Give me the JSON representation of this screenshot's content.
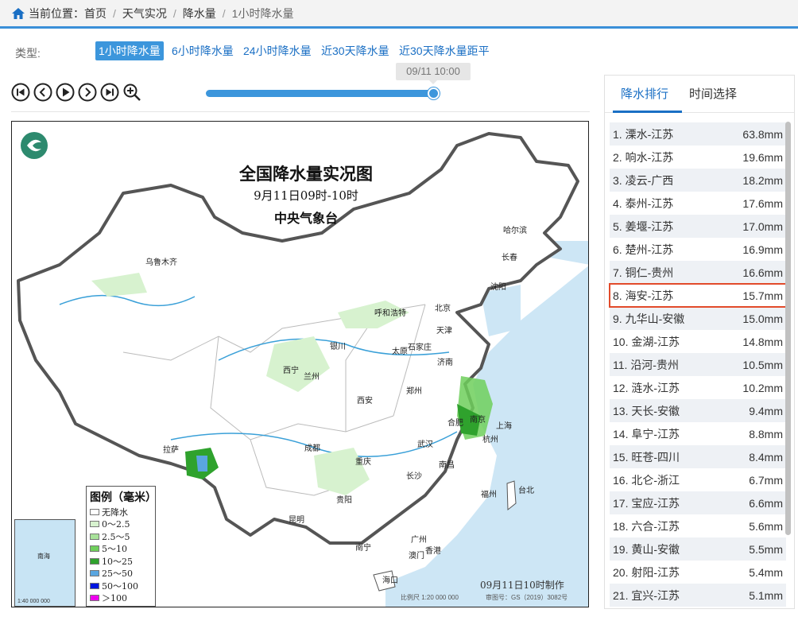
{
  "breadcrumb": {
    "prefix": "当前位置：",
    "items": [
      "首页",
      "天气实况",
      "降水量",
      "1小时降水量"
    ]
  },
  "types": {
    "label": "类型:",
    "tabs": [
      "1小时降水量",
      "6小时降水量",
      "24小时降水量",
      "近30天降水量",
      "近30天降水量距平"
    ],
    "active": "1小时降水量"
  },
  "player": {
    "time_tip": "09/11 10:00",
    "progress": 1.0,
    "buttons": [
      "first-icon",
      "prev-icon",
      "play-icon",
      "next-icon",
      "last-icon",
      "zoom-in-icon"
    ]
  },
  "map": {
    "title": "全国降水量实况图",
    "subtitle": "9月11日09时-10时",
    "publisher": "中央气象台",
    "made": "09月11日10时制作",
    "scale": "比例尺 1:20 000 000",
    "review": "审图号：GS（2019）3082号",
    "inset_label": "1:40 000 000",
    "inset_sea": "南海",
    "cities": [
      "乌鲁木齐",
      "哈尔滨",
      "长春",
      "沈阳",
      "呼和浩特",
      "北京",
      "天津",
      "银川",
      "太原",
      "石家庄",
      "西宁",
      "兰州",
      "济南",
      "郑州",
      "西安",
      "合肥",
      "南京",
      "上海",
      "杭州",
      "拉萨",
      "成都",
      "武汉",
      "重庆",
      "长沙",
      "南昌",
      "贵阳",
      "福州",
      "台北",
      "昆明",
      "南宁",
      "广州",
      "香港",
      "澳门",
      "海口"
    ],
    "legend": {
      "title": "图例（毫米）",
      "items": [
        {
          "label": "无降水",
          "color": "#ffffff"
        },
        {
          "label": "0～2.5",
          "color": "#d7f2cf"
        },
        {
          "label": "2.5～5",
          "color": "#a8e29a"
        },
        {
          "label": "5～10",
          "color": "#6fcf5c"
        },
        {
          "label": "10～25",
          "color": "#2fa22d"
        },
        {
          "label": "25～50",
          "color": "#5aa6e0"
        },
        {
          "label": "50～100",
          "color": "#0016e0"
        },
        {
          "label": "＞100",
          "color": "#ee00ee"
        }
      ]
    }
  },
  "panel": {
    "tabs": [
      "降水排行",
      "时间选择"
    ],
    "active_tab": "降水排行",
    "ranking": [
      {
        "name": "1. 溧水-江苏",
        "value": "63.8mm"
      },
      {
        "name": "2. 响水-江苏",
        "value": "19.6mm"
      },
      {
        "name": "3. 凌云-广西",
        "value": "18.2mm"
      },
      {
        "name": "4. 泰州-江苏",
        "value": "17.6mm"
      },
      {
        "name": "5. 姜堰-江苏",
        "value": "17.0mm"
      },
      {
        "name": "6. 楚州-江苏",
        "value": "16.9mm"
      },
      {
        "name": "7. 铜仁-贵州",
        "value": "16.6mm"
      },
      {
        "name": "8. 海安-江苏",
        "value": "15.7mm"
      },
      {
        "name": "9. 九华山-安徽",
        "value": "15.0mm"
      },
      {
        "name": "10. 金湖-江苏",
        "value": "14.8mm"
      },
      {
        "name": "11. 沿河-贵州",
        "value": "10.5mm"
      },
      {
        "name": "12. 涟水-江苏",
        "value": "10.2mm"
      },
      {
        "name": "13. 天长-安徽",
        "value": "9.4mm"
      },
      {
        "name": "14. 阜宁-江苏",
        "value": "8.8mm"
      },
      {
        "name": "15. 旺苍-四川",
        "value": "8.4mm"
      },
      {
        "name": "16. 北仑-浙江",
        "value": "6.7mm"
      },
      {
        "name": "17. 宝应-江苏",
        "value": "6.6mm"
      },
      {
        "name": "18. 六合-江苏",
        "value": "5.6mm"
      },
      {
        "name": "19. 黄山-安徽",
        "value": "5.5mm"
      },
      {
        "name": "20. 射阳-江苏",
        "value": "5.4mm"
      },
      {
        "name": "21. 宜兴-江苏",
        "value": "5.1mm"
      }
    ],
    "highlighted_rank": "8. 海安-江苏"
  },
  "colors": {
    "accent": "#3c96dc",
    "link": "#1a6fc4",
    "highlight": "#e24b2b"
  }
}
